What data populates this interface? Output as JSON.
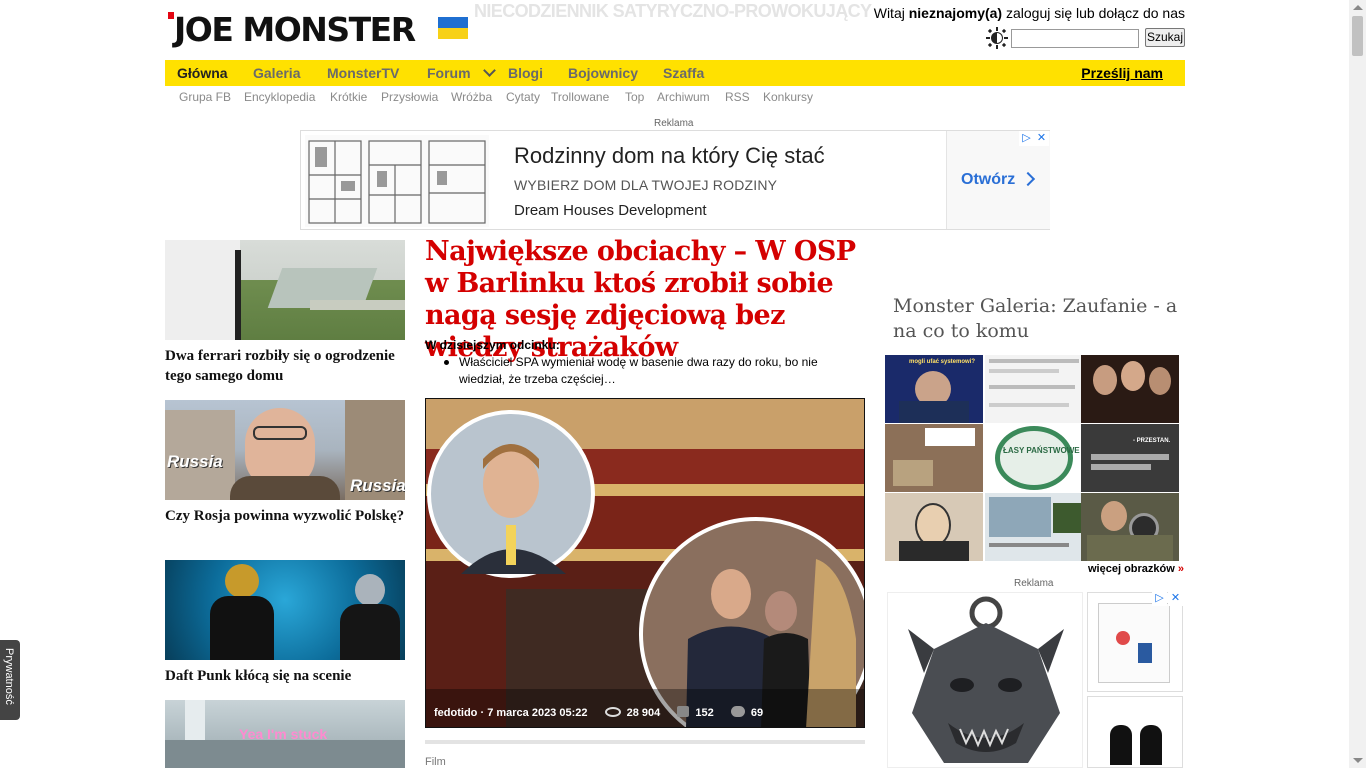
{
  "header": {
    "logo_text": "JOE MONSTER",
    "tagline": "NIECODZIENNIK SATYRYCZNO-PROWOKUJĄCY",
    "login": {
      "prefix": "Witaj ",
      "user": "nieznajomy(a)",
      "suffix": " zaloguj się lub dołącz do nas"
    },
    "search_button": "Szukaj",
    "search_value": ""
  },
  "nav": {
    "items": [
      "Główna",
      "Galeria",
      "MonsterTV",
      "Forum",
      "Blogi",
      "Bojownicy",
      "Szaffa"
    ],
    "submit": "Prześlij nam"
  },
  "subnav": [
    "Grupa FB",
    "Encyklopedia",
    "Krótkie",
    "Przysłowia",
    "Wróżba",
    "Cytaty",
    "Trollowane",
    "Top",
    "Archiwum",
    "RSS",
    "Konkursy"
  ],
  "ad_top": {
    "label": "Reklama",
    "title": "Rodzinny dom na który Cię stać",
    "subtitle": "WYBIERZ DOM DLA TWOJEJ RODZINY",
    "brand": "Dream Houses Development",
    "cta": "Otwórz"
  },
  "left_cards": [
    {
      "title": "Dwa ferrari rozbiły się o ogrodzenie tego samego domu"
    },
    {
      "title": "Czy Rosja powinna wyzwolić Polskę?",
      "overlay": "Russia"
    },
    {
      "title": "Daft Punk kłócą się na scenie"
    },
    {
      "title": "",
      "overlay": "Yea I'm stuck"
    }
  ],
  "article": {
    "headline": "Największe obciachy – W OSP w Barlinku ktoś zrobił sobie nagą sesję zdjęciową bez wiedzy strażaków",
    "intro": "W dzisiejszym odcinku:",
    "bullet": "Właściciel SPA wymieniał wodę w basenie dwa razy do roku, bo nie wiedział, że trzeba częściej…",
    "author": "fedotido",
    "date": "7 marca 2023 05:22",
    "views": "28 904",
    "votes": "152",
    "comments": "69",
    "next_label": "Film"
  },
  "gallery": {
    "title": "Monster Galeria: Zaufanie - a na co to komu",
    "more": "więcej obrazków",
    "more_arrow": "»",
    "thumb_texts": [
      "mogli ufać systemowi?",
      "- PRZESTAN.",
      "ŁASY PAŃSTWOWE"
    ]
  },
  "ad_right_label": "Reklama",
  "privacy": "Prywatność",
  "colors": {
    "nav_bg": "#ffe100",
    "headline": "#d40000",
    "accent_blue": "#2a6fd6"
  }
}
